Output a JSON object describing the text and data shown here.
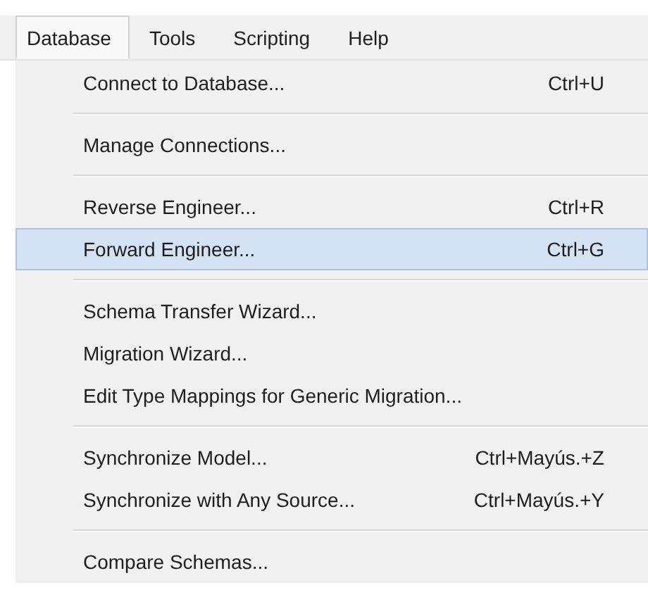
{
  "menu_bar": [
    {
      "label": "Database",
      "selected": true
    },
    {
      "label": "Tools",
      "selected": false
    },
    {
      "label": "Scripting",
      "selected": false
    },
    {
      "label": "Help",
      "selected": false
    }
  ],
  "menu": {
    "items": [
      {
        "label": "Connect to Database...",
        "shortcut": "Ctrl+U",
        "separator_before": false,
        "selected": false
      },
      {
        "label": "Manage Connections...",
        "separator_before": true,
        "selected": false
      },
      {
        "label": "Reverse Engineer...",
        "shortcut": "Ctrl+R",
        "separator_before": true,
        "selected": false
      },
      {
        "label": "Forward Engineer...",
        "shortcut": "Ctrl+G",
        "separator_before": false,
        "selected": true
      },
      {
        "label": "Schema Transfer Wizard...",
        "separator_before": true,
        "selected": false
      },
      {
        "label": "Migration Wizard...",
        "separator_before": false,
        "selected": false
      },
      {
        "label": "Edit Type Mappings for Generic Migration...",
        "separator_before": false,
        "selected": false
      },
      {
        "label": "Synchronize Model...",
        "shortcut": "Ctrl+Mayús.+Z",
        "separator_before": true,
        "selected": false
      },
      {
        "label": "Synchronize with Any Source...",
        "shortcut": "Ctrl+Mayús.+Y",
        "separator_before": false,
        "selected": false
      },
      {
        "label": "Compare Schemas...",
        "separator_before": true,
        "selected": false
      }
    ]
  }
}
